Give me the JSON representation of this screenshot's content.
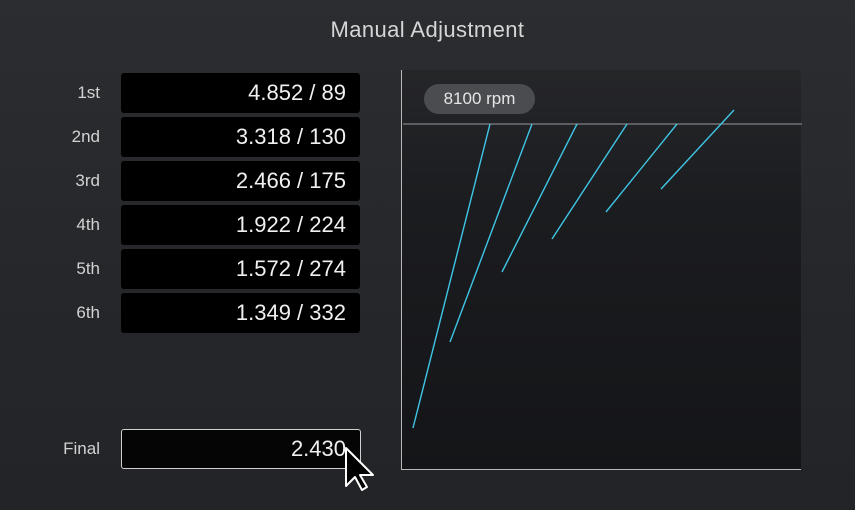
{
  "title": "Manual Adjustment",
  "gears": [
    {
      "label": "1st",
      "value": "4.852 / 89"
    },
    {
      "label": "2nd",
      "value": "3.318 / 130"
    },
    {
      "label": "3rd",
      "value": "2.466 / 175"
    },
    {
      "label": "4th",
      "value": "1.922 / 224"
    },
    {
      "label": "5th",
      "value": "1.572 / 274"
    },
    {
      "label": "6th",
      "value": "1.349 / 332"
    }
  ],
  "final": {
    "label": "Final",
    "value": "2.430"
  },
  "graph": {
    "rpm_label": "8100 rpm",
    "line_color": "#3fc6e6"
  }
}
